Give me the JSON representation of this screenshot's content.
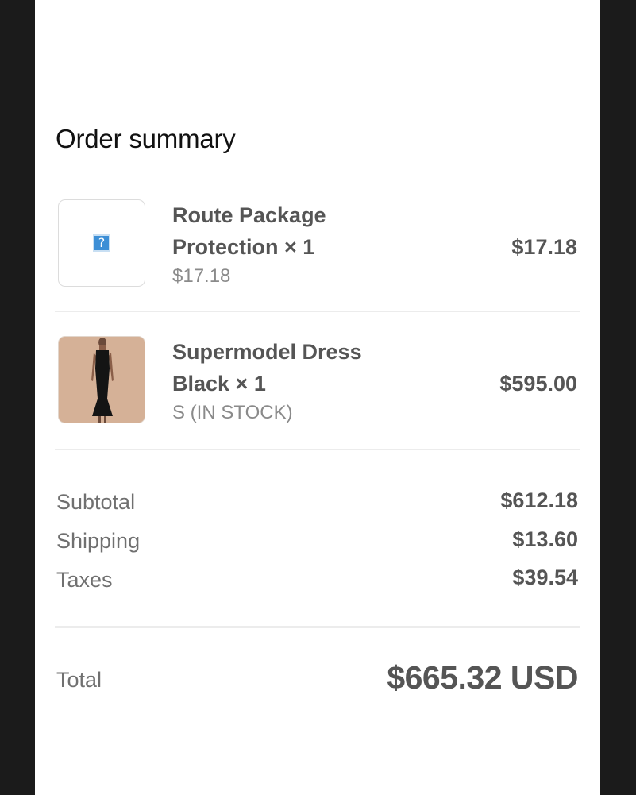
{
  "order_summary": {
    "title": "Order summary",
    "items": [
      {
        "name": "Route Package Protection × 1",
        "subtitle": "$17.18",
        "price": "$17.18",
        "image": "missing-image-icon"
      },
      {
        "name": "Supermodel Dress Black × 1",
        "subtitle": "S (IN STOCK)",
        "price": "$595.00",
        "image": "dress-photo"
      }
    ],
    "subtotal": {
      "label": "Subtotal",
      "value": "$612.18"
    },
    "shipping": {
      "label": "Shipping",
      "value": "$13.60"
    },
    "taxes": {
      "label": "Taxes",
      "value": "$39.54"
    },
    "total": {
      "label": "Total",
      "value": "$665.32 USD"
    }
  }
}
